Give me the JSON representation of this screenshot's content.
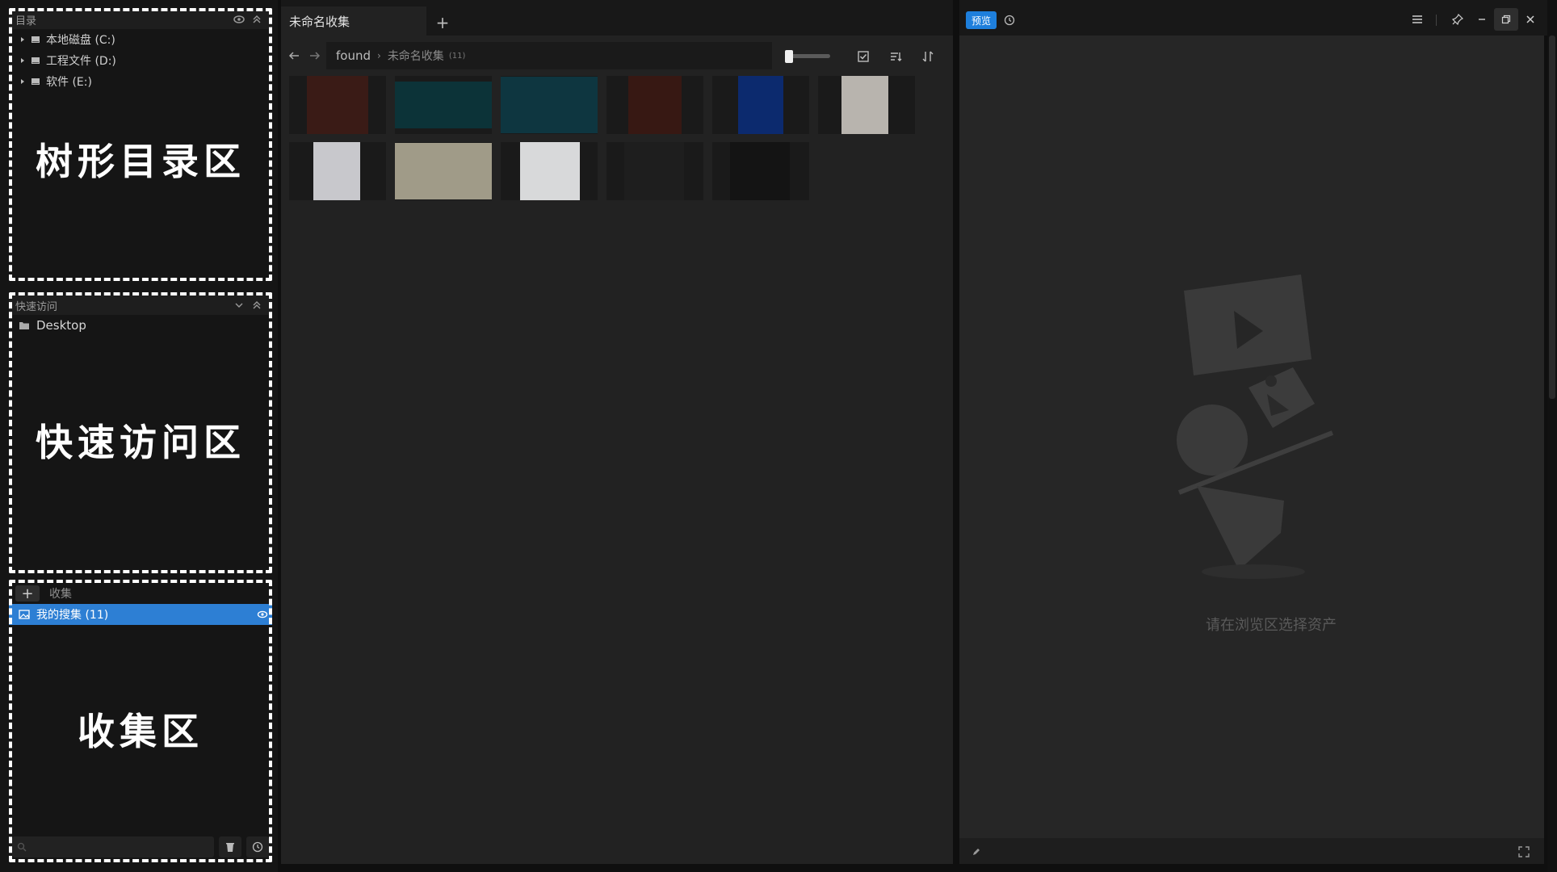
{
  "directory": {
    "title": "目录",
    "items": [
      {
        "label": "本地磁盘 (C:)"
      },
      {
        "label": "工程文件 (D:)"
      },
      {
        "label": "软件 (E:)"
      }
    ],
    "annotation": "树形目录区"
  },
  "quick_access": {
    "title": "快速访问",
    "items": [
      {
        "label": "Desktop"
      }
    ],
    "annotation": "快速访问区"
  },
  "collections": {
    "title": "收集",
    "items": [
      {
        "label": "我的搜集 (11)",
        "selected": true
      }
    ],
    "annotation": "收集区"
  },
  "browser": {
    "tab_label": "未命名收集",
    "breadcrumb": [
      "found",
      "未命名收集"
    ],
    "count": "(11)"
  },
  "preview": {
    "mode_label": "预览",
    "placeholder": "请在浏览区选择资产"
  },
  "thumbnails": [
    {
      "name": "thumb-red-figure",
      "bg": "#3a1b16"
    },
    {
      "name": "thumb-night-city",
      "bg": "#0c3338"
    },
    {
      "name": "thumb-night-city-2",
      "bg": "#0e3640"
    },
    {
      "name": "thumb-red-figure-2",
      "bg": "#371813"
    },
    {
      "name": "thumb-blue-robot",
      "bg": "#0c2a6e"
    },
    {
      "name": "thumb-isometric",
      "bg": "#b8b4ae"
    },
    {
      "name": "thumb-blue-machine",
      "bg": "#c8c8cc"
    },
    {
      "name": "thumb-colorful-poster",
      "bg": "#a09b88"
    },
    {
      "name": "thumb-yellow-radio",
      "bg": "#d8d9da"
    },
    {
      "name": "thumb-dark-shoe",
      "bg": "#1e1e1e"
    },
    {
      "name": "thumb-dark-sneaker",
      "bg": "#141414"
    }
  ],
  "colors": {
    "accent": "#2d7fd4",
    "preview_button": "#1e7fdc"
  }
}
